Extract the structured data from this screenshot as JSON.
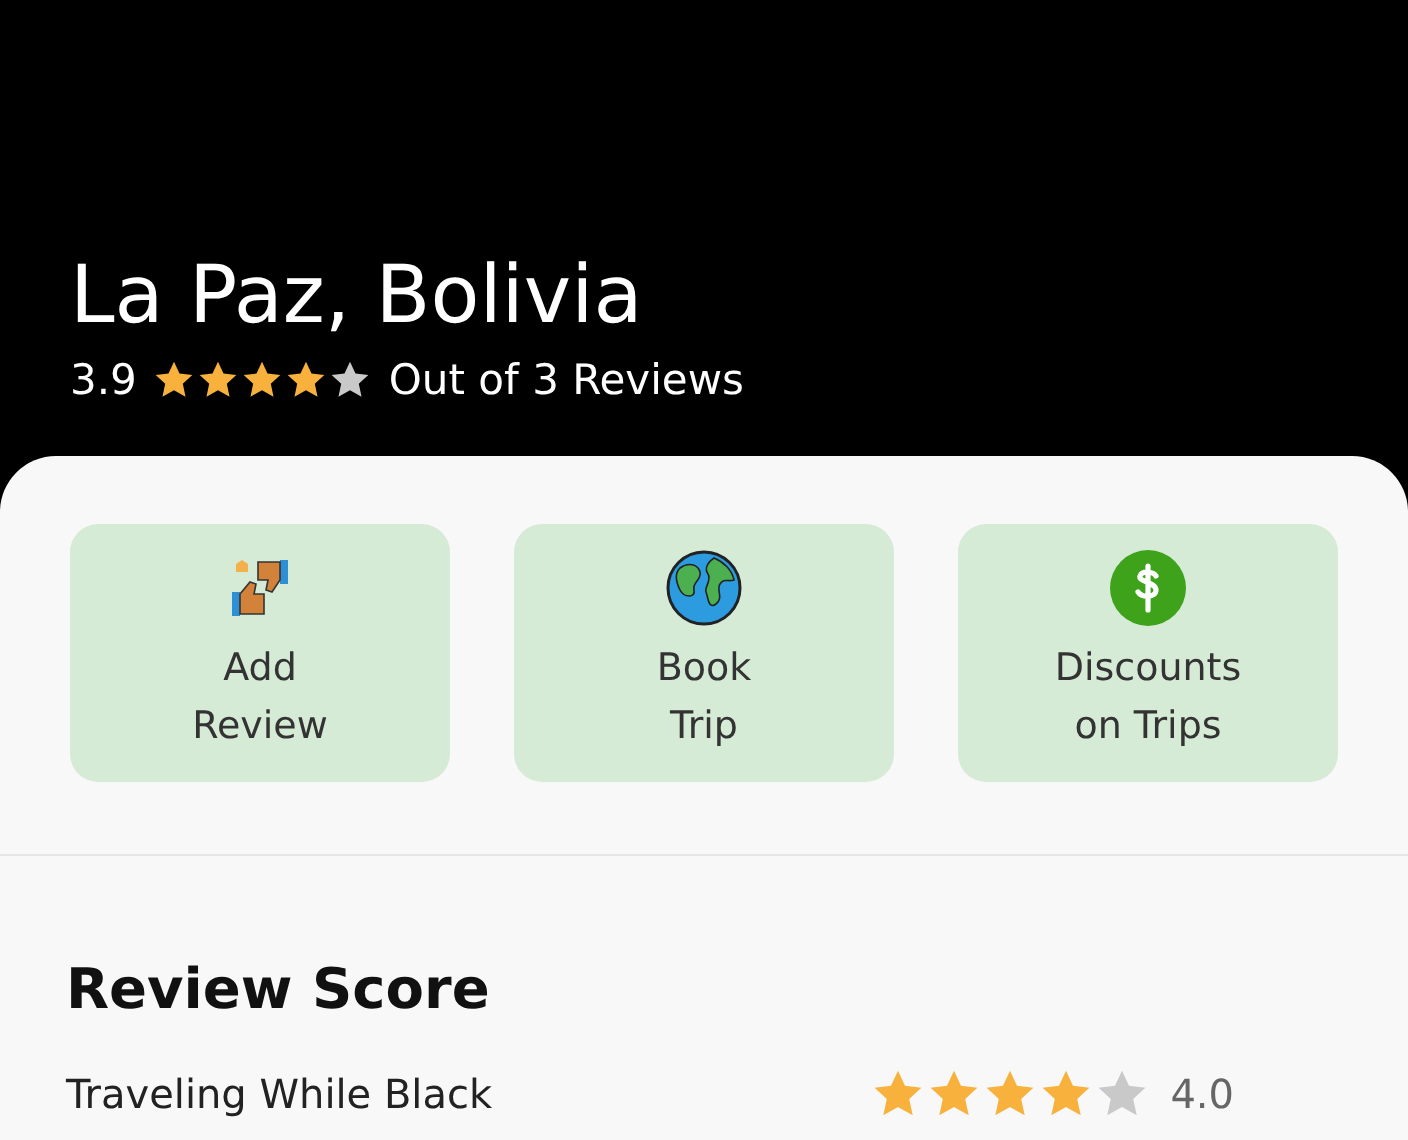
{
  "place": {
    "title": "La Paz, Bolivia",
    "rating": "3.9",
    "stars": 4,
    "reviews": "Out of 3 Reviews"
  },
  "actions": [
    {
      "kind": "review",
      "label": "Add\nReview"
    },
    {
      "kind": "globe",
      "label": "Book\nTrip"
    },
    {
      "kind": "dollar",
      "label": "Discounts\non Trips"
    }
  ],
  "review_score": {
    "title": "Review Score",
    "rows": [
      {
        "label": "Traveling While Black",
        "stars": 4,
        "score": "4.0"
      }
    ]
  }
}
